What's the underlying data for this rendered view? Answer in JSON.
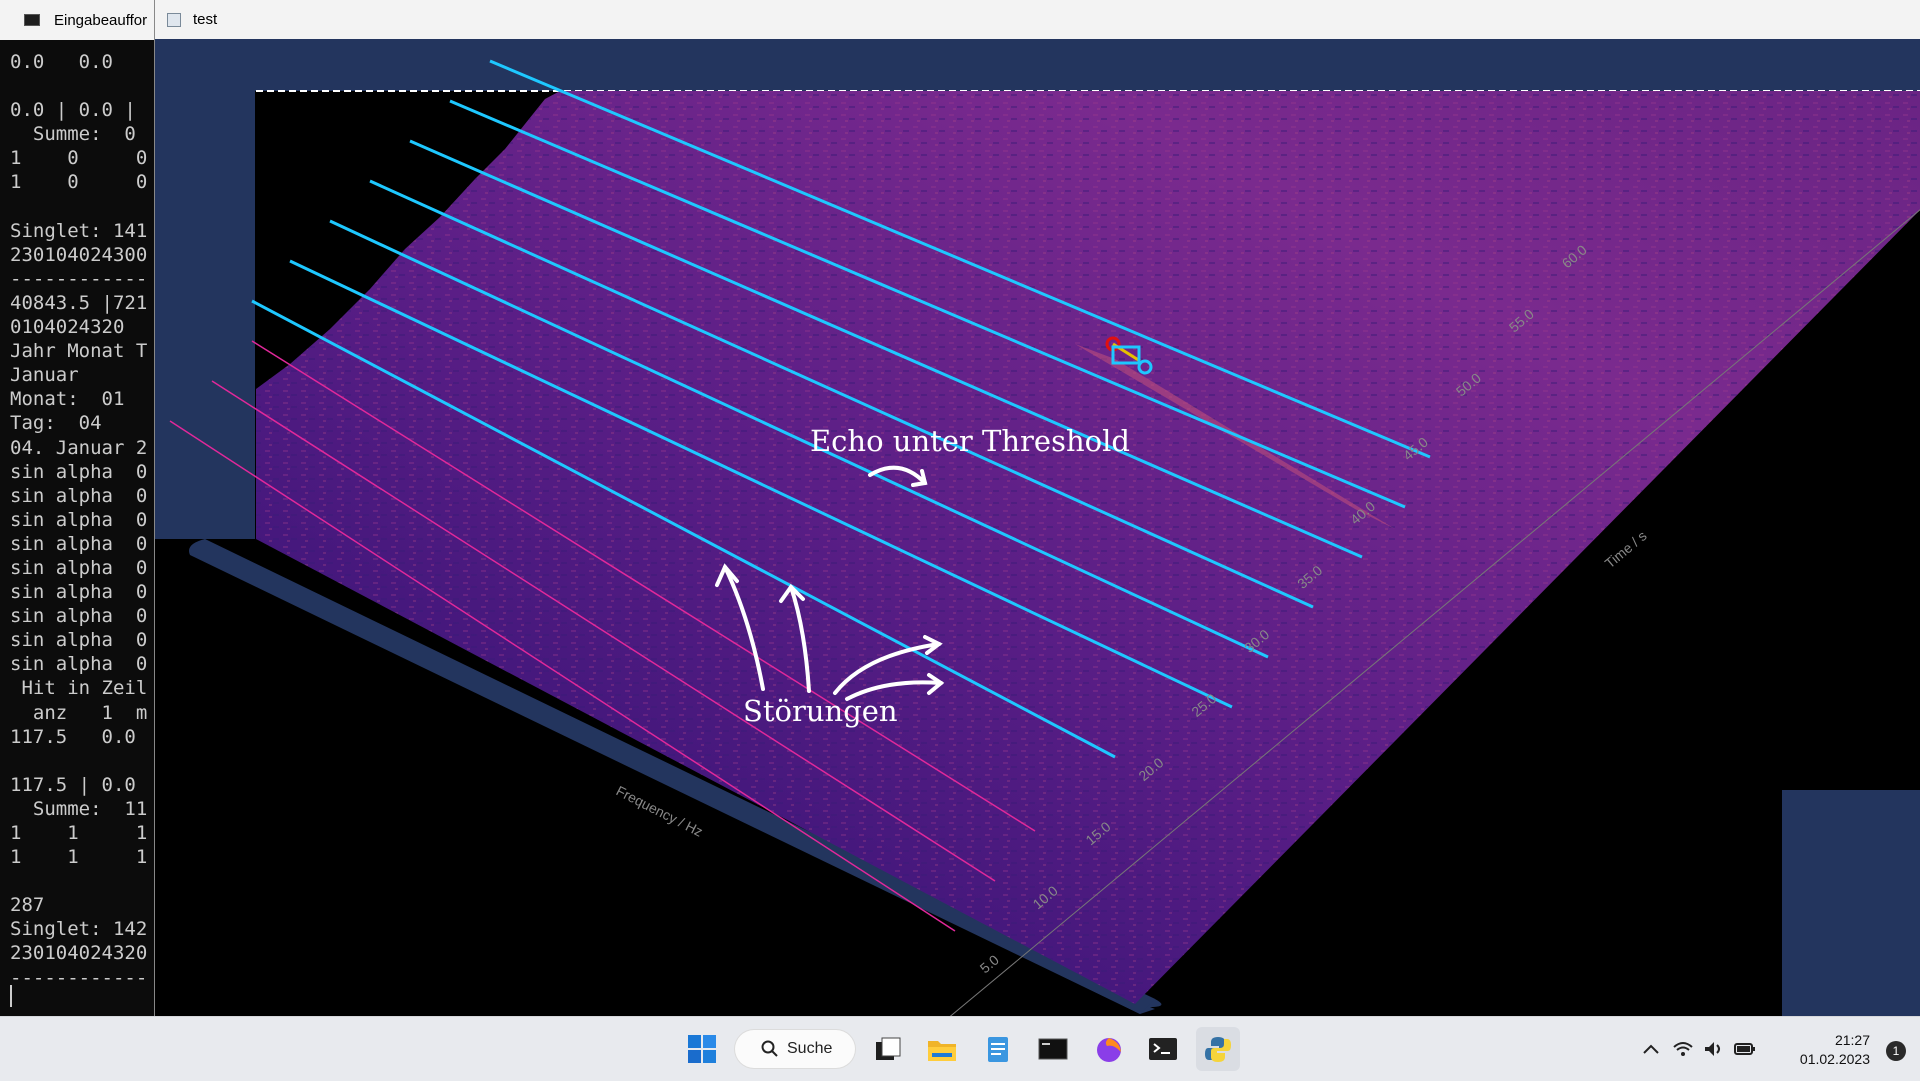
{
  "console": {
    "title": "Eingabeauffor",
    "lines": [
      "0.0   0.0",
      "",
      "0.0 | 0.0 |",
      "  Summe:  0",
      "1    0     0",
      "1    0     0",
      "",
      "Singlet: 141",
      "230104024300",
      "------------",
      "40843.5 |721",
      "0104024320",
      "Jahr Monat T",
      "Januar",
      "Monat:  01",
      "Tag:  04",
      "04. Januar 2",
      "sin alpha  0",
      "sin alpha  0",
      "sin alpha  0",
      "sin alpha  0",
      "sin alpha  0",
      "sin alpha  0",
      "sin alpha  0",
      "sin alpha  0",
      "sin alpha  0",
      " Hit in Zeil",
      "  anz   1  m",
      "117.5   0.0",
      "",
      "117.5 | 0.0",
      "  Summe:  11",
      "1    1     1",
      "1    1     1",
      "",
      "287",
      "Singlet: 142",
      "230104024320",
      "------------"
    ]
  },
  "plot_window": {
    "title": "test",
    "annotations": {
      "echo": "Echo unter Threshold",
      "noise": "Störungen"
    },
    "axes": {
      "frequency_label": "Frequency / Hz",
      "time_label": "Time / s",
      "time_ticks": [
        "5.0",
        "10.0",
        "15.0",
        "20.0",
        "25.0",
        "30.0",
        "35.0",
        "40.0",
        "45.0",
        "50.0",
        "55.0",
        "60.0"
      ]
    },
    "colors": {
      "frame": "#23355e",
      "marker_lines": "#1ec8ff",
      "pink_lines": "#e0289a",
      "spectrum_dark": "#2a1070",
      "spectrum_mid": "#7a2a8e",
      "spectrum_hot": "#c2507a"
    }
  },
  "taskbar": {
    "search_label": "Suche",
    "apps": [
      "start-icon",
      "task-view-icon",
      "file-explorer-icon",
      "notepad-icon",
      "terminal-icon",
      "firefox-icon",
      "console-icon",
      "python-icon"
    ],
    "time": "21:27",
    "date": "01.02.2023",
    "notification_count": "1"
  }
}
